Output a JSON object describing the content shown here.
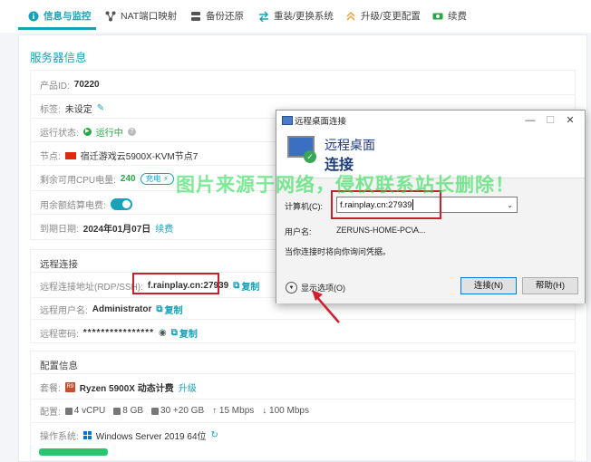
{
  "tabs": [
    {
      "label": "信息与监控",
      "icon": "info-icon"
    },
    {
      "label": "NAT端口映射",
      "icon": "network-icon"
    },
    {
      "label": "备份还原",
      "icon": "database-icon"
    },
    {
      "label": "重装/更换系统",
      "icon": "swap-icon"
    },
    {
      "label": "升级/变更配置",
      "icon": "upgrade-icon"
    },
    {
      "label": "续费",
      "icon": "money-icon"
    }
  ],
  "card_title": "服务器信息",
  "server": {
    "product_id_label": "产品ID:",
    "product_id": "70220",
    "tag_label": "标签:",
    "tag_value": "未设定",
    "status_label": "运行状态:",
    "status_value": "运行中",
    "node_label": "节点:",
    "node_value": "宿迁游戏云5900X-KVM节点7",
    "cpu_label": "剩余可用CPU电量:",
    "cpu_value": "240",
    "charge_badge": "充电",
    "balance_label": "用余额结算电费:",
    "expire_label": "到期日期:",
    "expire_value": "2024年01月07日",
    "renew_link": "续费"
  },
  "remote": {
    "title": "远程连接",
    "addr_label": "远程连接地址(RDP/SSH):",
    "addr_value": "f.rainplay.cn:27939",
    "user_label": "远程用户名:",
    "user_value": "Administrator",
    "pass_label": "远程密码:",
    "pass_value": "****************",
    "copy_label": "复制"
  },
  "config": {
    "title": "配置信息",
    "plan_label": "套餐:",
    "plan_value": "Ryzen 5900X 动态计费",
    "upgrade_link": "升级",
    "spec_label": "配置:",
    "specs": [
      "4 vCPU",
      "8 GB",
      "30 +20 GB",
      "↑ 15 Mbps",
      "↓ 100 Mbps"
    ],
    "os_label": "操作系统:",
    "os_value": "Windows Server 2019 64位"
  },
  "dialog": {
    "window_title": "远程桌面连接",
    "banner_line1": "远程桌面",
    "banner_line2": "连接",
    "computer_label": "计算机(C):",
    "computer_value": "f.rainplay.cn:27939",
    "username_label": "用户名:",
    "username_value": "ZERUNS-HOME-PC\\A...",
    "note": "当你连接时将向你询问凭据。",
    "show_options": "显示选项(O)",
    "connect_button": "连接(N)",
    "help_button": "帮助(H)"
  },
  "watermark": "图片来源于网络，侵权联系站长删除！",
  "colors": {
    "accent": "#17a2b8",
    "highlight": "#c8202f",
    "watermark": "#28dc50"
  }
}
